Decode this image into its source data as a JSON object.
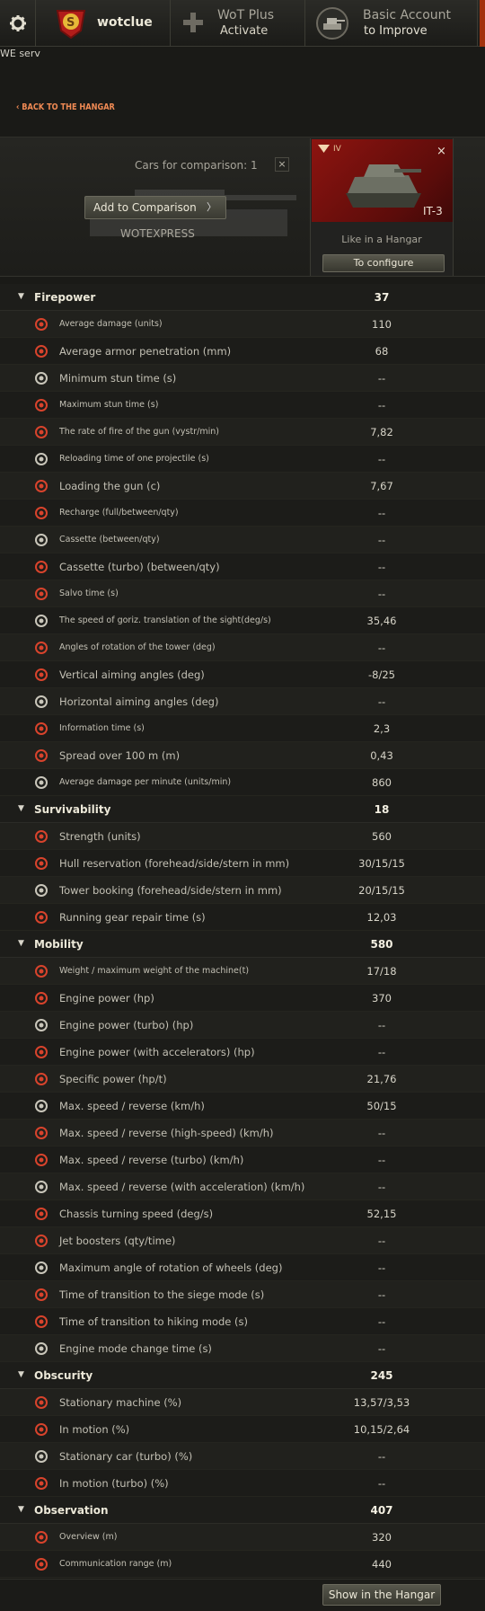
{
  "topbar": {
    "username": "wotclue",
    "wot_plus_title": "WoT Plus",
    "wot_plus_action": "Activate",
    "account_title": "Basic Account",
    "account_action": "to Improve",
    "server": "WE serv"
  },
  "back_link": "BACK TO THE HANGAR",
  "comparison": {
    "title": "Cars for comparison: 1",
    "close_label": "×",
    "add_button": "Add to Comparison",
    "server_label": "WOTEXPRESS",
    "vehicle": {
      "tier": "IV",
      "name": "IT-3",
      "close_label": "×",
      "like_in_hangar": "Like in a Hangar",
      "configure_button": "To configure",
      "flag_color": "#8d1410"
    }
  },
  "sections": [
    {
      "name": "Firepower",
      "value": "37",
      "rows": [
        {
          "label": "Average damage (units)",
          "value": "110",
          "small": true,
          "icon": "damage-icon"
        },
        {
          "label": "Average armor penetration (mm)",
          "value": "68",
          "small": false,
          "icon": "penetration-icon"
        },
        {
          "label": "Minimum stun time (s)",
          "value": "--",
          "small": false,
          "icon": "stun-min-icon"
        },
        {
          "label": "Maximum stun time (s)",
          "value": "--",
          "small": true,
          "icon": "stun-max-icon"
        },
        {
          "label": "The rate of fire of the gun (vystr/min)",
          "value": "7,82",
          "small": true,
          "icon": "rate-of-fire-icon"
        },
        {
          "label": "Reloading time of one projectile (s)",
          "value": "--",
          "small": true,
          "icon": "shell-reload-icon"
        },
        {
          "label": "Loading the gun (c)",
          "value": "7,67",
          "small": false,
          "icon": "gun-loading-icon"
        },
        {
          "label": "Recharge (full/between/qty)",
          "value": "--",
          "small": true,
          "icon": "recharge-icon"
        },
        {
          "label": "Cassette (between/qty)",
          "value": "--",
          "small": true,
          "icon": "cassette-icon"
        },
        {
          "label": "Cassette (turbo) (between/qty)",
          "value": "--",
          "small": false,
          "icon": "cassette-turbo-icon"
        },
        {
          "label": "Salvo time (s)",
          "value": "--",
          "small": true,
          "icon": "salvo-icon"
        },
        {
          "label": "The speed of goriz. translation of the sight(deg/s)",
          "value": "35,46",
          "small": true,
          "icon": "aim-speed-icon"
        },
        {
          "label": "Angles of rotation of the tower (deg)",
          "value": "--",
          "small": true,
          "icon": "turret-rotation-icon"
        },
        {
          "label": "Vertical aiming angles (deg)",
          "value": "-8/25",
          "small": false,
          "icon": "vertical-angles-icon"
        },
        {
          "label": "Horizontal aiming angles (deg)",
          "value": "--",
          "small": false,
          "icon": "horizontal-angles-icon"
        },
        {
          "label": "Information time (s)",
          "value": "2,3",
          "small": true,
          "icon": "aiming-time-icon"
        },
        {
          "label": "Spread over 100 m (m)",
          "value": "0,43",
          "small": false,
          "icon": "dispersion-icon"
        },
        {
          "label": "Average damage per minute (units/min)",
          "value": "860",
          "small": true,
          "icon": "dpm-icon"
        }
      ]
    },
    {
      "name": "Survivability",
      "value": "18",
      "rows": [
        {
          "label": "Strength (units)",
          "value": "560",
          "small": false,
          "icon": "hitpoints-icon"
        },
        {
          "label": "Hull reservation (forehead/side/stern in mm)",
          "value": "30/15/15",
          "small": false,
          "icon": "hull-armor-icon"
        },
        {
          "label": "Tower booking (forehead/side/stern in mm)",
          "value": "20/15/15",
          "small": false,
          "icon": "turret-armor-icon"
        },
        {
          "label": "Running gear repair time (s)",
          "value": "12,03",
          "small": false,
          "icon": "repair-icon"
        }
      ]
    },
    {
      "name": "Mobility",
      "value": "580",
      "rows": [
        {
          "label": "Weight / maximum weight of the machine(t)",
          "value": "17/18",
          "small": true,
          "icon": "weight-icon"
        },
        {
          "label": "Engine power (hp)",
          "value": "370",
          "small": false,
          "icon": "engine-icon"
        },
        {
          "label": "Engine power (turbo) (hp)",
          "value": "--",
          "small": false,
          "icon": "engine-turbo-icon"
        },
        {
          "label": "Engine power (with accelerators) (hp)",
          "value": "--",
          "small": false,
          "icon": "engine-boost-icon"
        },
        {
          "label": "Specific power (hp/t)",
          "value": "21,76",
          "small": false,
          "icon": "specific-power-icon"
        },
        {
          "label": "Max. speed / reverse (km/h)",
          "value": "50/15",
          "small": false,
          "icon": "speed-icon"
        },
        {
          "label": "Max. speed / reverse (high-speed)           (km/h)",
          "value": "--",
          "small": false,
          "icon": "speed-high-icon"
        },
        {
          "label": "Max. speed / reverse (turbo) (km/h)",
          "value": "--",
          "small": false,
          "icon": "speed-turbo-icon"
        },
        {
          "label": "Max. speed / reverse (with acceleration) (km/h)",
          "value": "--",
          "small": false,
          "icon": "speed-boost-icon"
        },
        {
          "label": "Chassis turning speed (deg/s)",
          "value": "52,15",
          "small": false,
          "icon": "traverse-icon"
        },
        {
          "label": "Jet boosters (qty/time)",
          "value": "--",
          "small": false,
          "icon": "jet-booster-icon"
        },
        {
          "label": "Maximum angle of rotation of wheels (deg)",
          "value": "--",
          "small": false,
          "icon": "wheel-angle-icon"
        },
        {
          "label": "Time of transition to the siege mode (s)",
          "value": "--",
          "small": false,
          "icon": "siege-mode-icon"
        },
        {
          "label": "Time of transition to hiking mode (s)",
          "value": "--",
          "small": false,
          "icon": "travel-mode-icon"
        },
        {
          "label": "Engine mode change time (s)",
          "value": "--",
          "small": false,
          "icon": "engine-mode-icon"
        }
      ]
    },
    {
      "name": "Obscurity",
      "value": "245",
      "rows": [
        {
          "label": "Stationary machine (%)",
          "value": "13,57/3,53",
          "small": false,
          "icon": "camo-stationary-icon"
        },
        {
          "label": "In motion (%)",
          "value": "10,15/2,64",
          "small": false,
          "icon": "camo-moving-icon"
        },
        {
          "label": "Stationary car (turbo) (%)",
          "value": "--",
          "small": false,
          "icon": "camo-stationary-turbo-icon"
        },
        {
          "label": "In motion (turbo) (%)",
          "value": "--",
          "small": false,
          "icon": "camo-moving-turbo-icon"
        }
      ]
    },
    {
      "name": "Observation",
      "value": "407",
      "rows": [
        {
          "label": "Overview (m)",
          "value": "320",
          "small": true,
          "icon": "view-range-icon"
        },
        {
          "label": "Communication range (m)",
          "value": "440",
          "small": true,
          "icon": "radio-range-icon"
        }
      ]
    }
  ],
  "footer": {
    "show_in_hangar": "Show in the Hangar"
  },
  "colors": {
    "accent": "#f08a54",
    "background": "#1a1a17",
    "icon_red": "#d8432c"
  }
}
